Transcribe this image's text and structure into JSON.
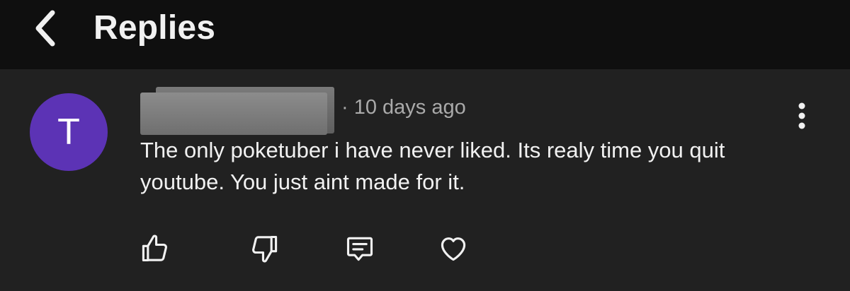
{
  "header": {
    "title": "Replies",
    "back_icon": "chevron-left-icon"
  },
  "comment": {
    "avatar_letter": "T",
    "avatar_color": "#5c33b5",
    "time": "· 10 days ago",
    "text": "The only poketuber i have never liked. Its realy time you quit youtube. You just aint made for it.",
    "menu_icon": "more-vertical-icon",
    "actions": [
      {
        "icon": "thumbs-up-icon"
      },
      {
        "icon": "thumbs-down-icon"
      },
      {
        "icon": "reply-comment-icon"
      },
      {
        "icon": "heart-icon"
      }
    ]
  }
}
